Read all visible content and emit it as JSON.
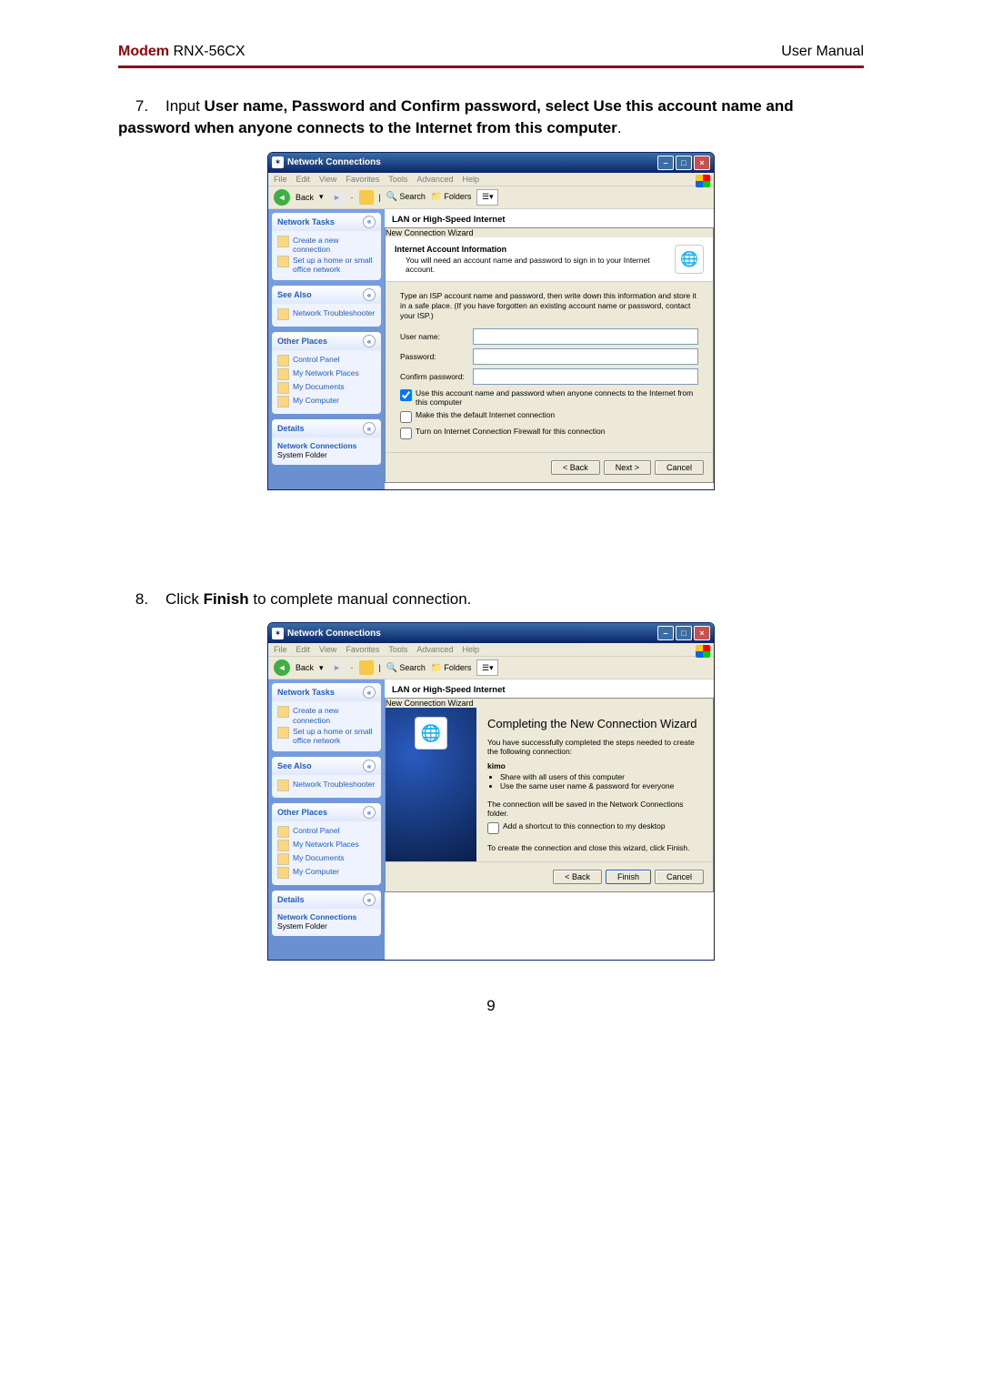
{
  "header": {
    "product": "Modem",
    "model": "RNX-56CX",
    "manual": "User Manual"
  },
  "step7": {
    "num": "7.",
    "lead": "Input ",
    "bold": "User name, Password and Confirm password, select Use this account name and password when anyone connects to the Internet from this computer",
    "tail": "."
  },
  "step8": {
    "num": "8.",
    "lead": "Click ",
    "bold": "Finish",
    "tail": " to complete manual connection."
  },
  "page_number": "9",
  "winA": {
    "title": "Network Connections",
    "menu": [
      "File",
      "Edit",
      "View",
      "Favorites",
      "Tools",
      "Advanced",
      "Help"
    ],
    "toolbar": {
      "back": "Back",
      "search": "Search",
      "folders": "Folders"
    },
    "main_section": "LAN or High-Speed Internet",
    "sidebar": {
      "tasks_head": "Network Tasks",
      "tasks": [
        "Create a new connection",
        "Set up a home or small office network"
      ],
      "see_head": "See Also",
      "see": [
        "Network Troubleshooter"
      ],
      "other_head": "Other Places",
      "other": [
        "Control Panel",
        "My Network Places",
        "My Documents",
        "My Computer"
      ],
      "details_head": "Details",
      "details_title": "Network Connections",
      "details_sub": "System Folder"
    },
    "wizard": {
      "banner": "New Connection Wizard",
      "heading": "Internet Account Information",
      "subheading": "You will need an account name and password to sign in to your Internet account.",
      "desc": "Type an ISP account name and password, then write down this information and store it in a safe place. (If you have forgotten an existing account name or password, contact your ISP.)",
      "user_label": "User name:",
      "pass_label": "Password:",
      "confirm_label": "Confirm password:",
      "chk1": "Use this account name and password when anyone connects to the Internet from this computer",
      "chk2": "Make this the default Internet connection",
      "chk3": "Turn on Internet Connection Firewall for this connection",
      "back": "< Back",
      "next": "Next >",
      "cancel": "Cancel"
    }
  },
  "winB": {
    "wizard": {
      "banner": "New Connection Wizard",
      "title_big": "Completing the New Connection Wizard",
      "line1": "You have successfully completed the steps needed to create the following connection:",
      "name": "kimo",
      "bul1": "Share with all users of this computer",
      "bul2": "Use the same user name & password for everyone",
      "line2": "The connection will be saved in the Network Connections folder.",
      "chk": "Add a shortcut to this connection to my desktop",
      "line3": "To create the connection and close this wizard, click Finish.",
      "back": "< Back",
      "finish": "Finish",
      "cancel": "Cancel"
    }
  }
}
